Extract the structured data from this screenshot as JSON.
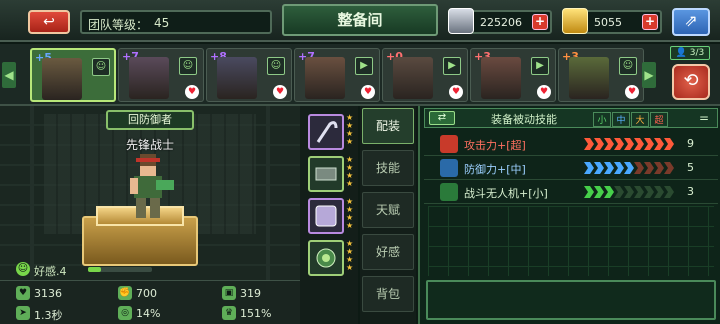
{
  "header": {
    "back_icon": "back-arrow-icon",
    "team_level_label": "团队等级：",
    "team_level_value": "45",
    "title": "整备间",
    "resources": [
      {
        "icon": "silver-ingot-icon",
        "value": "225206"
      },
      {
        "icon": "gold-bar-icon",
        "value": "5055"
      }
    ],
    "plus_label": "+",
    "share_icon": "share-icon"
  },
  "roster": {
    "team_count": "3/3",
    "heroes": [
      {
        "plus": "+5",
        "selected": true,
        "badge": "person-icon",
        "plus_color": "#6aa6ff"
      },
      {
        "plus": "+7",
        "selected": false,
        "badge": "person-icon",
        "plus_color": "#b070ff"
      },
      {
        "plus": "+8",
        "selected": false,
        "badge": "person-icon",
        "plus_color": "#b070ff"
      },
      {
        "plus": "+7",
        "selected": false,
        "badge": "vehicle-icon",
        "plus_color": "#b070ff"
      },
      {
        "plus": "+0",
        "selected": false,
        "badge": "vehicle-icon",
        "plus_color": "#ff7070"
      },
      {
        "plus": "+3",
        "selected": false,
        "badge": "vehicle-icon",
        "plus_color": "#ff7070"
      },
      {
        "plus": "+3",
        "selected": false,
        "badge": "person-icon",
        "plus_color": "#ff9040"
      }
    ]
  },
  "hero": {
    "role": "回防御者",
    "name": "先锋战士",
    "affinity_label": "好感.4",
    "affinity_fraction": 0.2
  },
  "stats": [
    {
      "icon": "heart-icon",
      "value": "3136"
    },
    {
      "icon": "attack-icon",
      "value": "700"
    },
    {
      "icon": "armor-icon",
      "value": "319"
    },
    {
      "icon": "speed-icon",
      "value": "1.3秒"
    },
    {
      "icon": "crit-icon",
      "value": "14%"
    },
    {
      "icon": "crown-icon",
      "value": "151%"
    }
  ],
  "tabs": [
    "配装",
    "技能",
    "天赋",
    "好感",
    "背包"
  ],
  "skills": {
    "title": "装备被动技能",
    "sizes": [
      "小",
      "中",
      "大",
      "超"
    ],
    "eq_sign": "=",
    "rows": [
      {
        "icon": "attack-up-icon",
        "name": "攻击力+[超]",
        "name_color": "#ff7060",
        "count": "9",
        "arrows": [
          "#ff5a3a",
          "#ff5a3a",
          "#ff5a3a",
          "#ff5a3a",
          "#ff5a3a",
          "#ff5a3a",
          "#ff5a3a",
          "#ff5a3a",
          "#ff5a3a"
        ]
      },
      {
        "icon": "defense-up-icon",
        "name": "防御力+[中]",
        "name_color": "#9cd0ff",
        "count": "5",
        "arrows": [
          "#4aa8ff",
          "#4aa8ff",
          "#4aa8ff",
          "#4aa8ff",
          "#4aa8ff",
          "#7a3a2a",
          "#7a3a2a",
          "#7a3a2a",
          "#7a3a2a"
        ]
      },
      {
        "icon": "drone-icon",
        "name": "战斗无人机+[小]",
        "name_color": "#d8f0d0",
        "count": "3",
        "arrows": [
          "#46d04a",
          "#46d04a",
          "#46d04a",
          "#2a4a30",
          "#2a4a30",
          "#2a4a30",
          "#2a4a30",
          "#2a4a30",
          "#2a4a30"
        ]
      }
    ]
  }
}
